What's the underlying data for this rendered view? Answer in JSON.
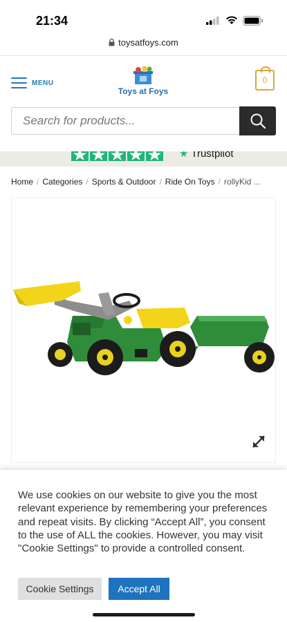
{
  "status_bar": {
    "time": "21:34"
  },
  "browser": {
    "url": "toysatfoys.com"
  },
  "header": {
    "menu_label": "MENU",
    "logo_text": "Toys at Foys",
    "cart_count": "0"
  },
  "search": {
    "placeholder": "Search for products..."
  },
  "trust": {
    "brand": "Trustpilot"
  },
  "breadcrumb": {
    "items": [
      "Home",
      "Categories",
      "Sports & Outdoor",
      "Ride On Toys",
      "rollyKid ..."
    ]
  },
  "cookie": {
    "text": "We use cookies on our website to give you the most relevant experience by remembering your preferences and repeat visits. By clicking “Accept All”, you consent to the use of ALL the cookies. However, you may visit \"Cookie Settings\" to provide a controlled consent.",
    "settings_label": "Cookie Settings",
    "accept_label": "Accept All"
  },
  "colors": {
    "accent": "#1e7ab7",
    "cart": "#d8a73a",
    "trustpilot_green": "#1fb67a",
    "accept_button": "#1e73be",
    "search_button": "#2b2b2b"
  },
  "icons": [
    "lock-icon",
    "hamburger-icon",
    "cart-icon",
    "search-icon",
    "expand-icon",
    "signal-icon",
    "wifi-icon",
    "battery-icon",
    "star-icon"
  ]
}
